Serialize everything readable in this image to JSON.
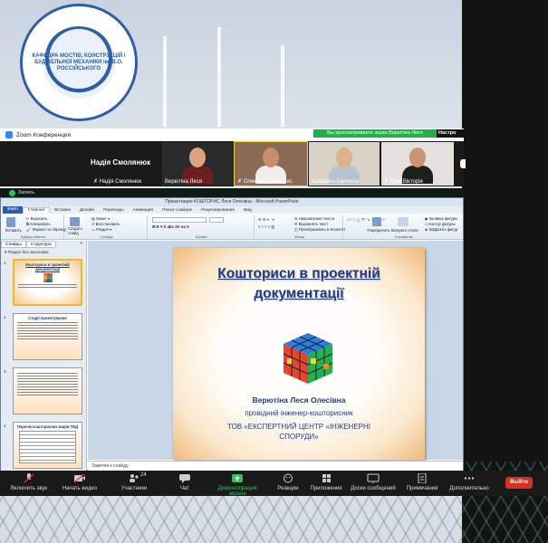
{
  "logo": {
    "ring_text": "КАФЕДРА МОСТІВ, КОНСТРУКЦІЙ І БУДІВЕЛЬНОЇ МЕХАНІКИ ім. В.О. РОССІЙСЬКОГО"
  },
  "zoom": {
    "window_title": "Zoom Конференция",
    "recording_banner": "Вы просматриваете экран Верютіна Леся",
    "recording_more": "Настро",
    "active_speaker_name": "Надія Смолянюк",
    "participants": [
      {
        "name": "Надія Смолянюк",
        "muted": true
      },
      {
        "name": "Верютіна Леся",
        "muted": false
      },
      {
        "name": "Олексій Сланченко",
        "muted": true
      },
      {
        "name": "Катерина Бережна",
        "muted": false
      },
      {
        "name": "Гура Вікторія",
        "muted": true
      }
    ],
    "record_label": "Запись"
  },
  "ppt": {
    "title": "Презентация КОШТОРИС Леся Олесівна - Microsoft PowerPoint",
    "tabs": [
      "Файл",
      "Главная",
      "Вставка",
      "Дизайн",
      "Переходы",
      "Анимация",
      "Показ слайдов",
      "Рецензирование",
      "Вид"
    ],
    "active_tab": "Главная",
    "ribbon": {
      "paste": "Вставить",
      "cut": "Вырезать",
      "copy": "Копировать",
      "format_painter": "Формат по образцу",
      "clipboard": "Буфер обмена",
      "new_slide": "Создать слайд",
      "layout": "Макет",
      "reset": "Восстановить",
      "section": "Раздел",
      "slides": "Слайды",
      "font": "Шрифт",
      "paragraph": "Абзац",
      "text_direction": "Направление текста",
      "align_text": "Выровнять текст",
      "convert_smartart": "Преобразовать в SmartArt",
      "arrange": "Упорядочить",
      "quick_styles": "Экспресс-стили",
      "shape_fill": "Заливка фигуры",
      "shape_outline": "Контур фигуры",
      "shape_effects": "Эффекты фигур",
      "drawing": "Рисование"
    },
    "left_tabs": [
      "Слайды",
      "Структура"
    ],
    "section_header": "Раздел без заголовка",
    "thumbnails": [
      {
        "num": "1",
        "title": "Кошториси в проектній документації"
      },
      {
        "num": "2",
        "title": "Стадії проектування"
      },
      {
        "num": "3",
        "title": ""
      },
      {
        "num": "4",
        "title": "Перелік кошторисних видів ПКД"
      }
    ],
    "slide": {
      "title": "Кошториси в проектній документації",
      "author": "Верютіна Леся Олесівна",
      "role": "провідний інженер-кошторисник",
      "organization": "ТОВ «ЕКСПЕРТНИЙ ЦЕНТР «ІНЖЕНЕРНІ СПОРУДИ»"
    },
    "notes_placeholder": "Заметки к слайду"
  },
  "toolbar": {
    "items": [
      {
        "label": "Включить звук",
        "icon": "mic-muted-icon"
      },
      {
        "label": "Начать видео",
        "icon": "video-off-icon"
      },
      {
        "label": "Участники",
        "icon": "participants-icon",
        "count": "24"
      },
      {
        "label": "Чат",
        "icon": "chat-icon"
      },
      {
        "label": "Демонстрация экрана",
        "icon": "share-screen-icon"
      },
      {
        "label": "Реакции",
        "icon": "reactions-icon"
      },
      {
        "label": "Приложения",
        "icon": "apps-icon"
      },
      {
        "label": "Доски сообщений",
        "icon": "whiteboard-icon"
      },
      {
        "label": "Примечания",
        "icon": "notes-icon"
      },
      {
        "label": "Дополнительно",
        "icon": "more-icon"
      }
    ],
    "end_label": "Выйти"
  }
}
